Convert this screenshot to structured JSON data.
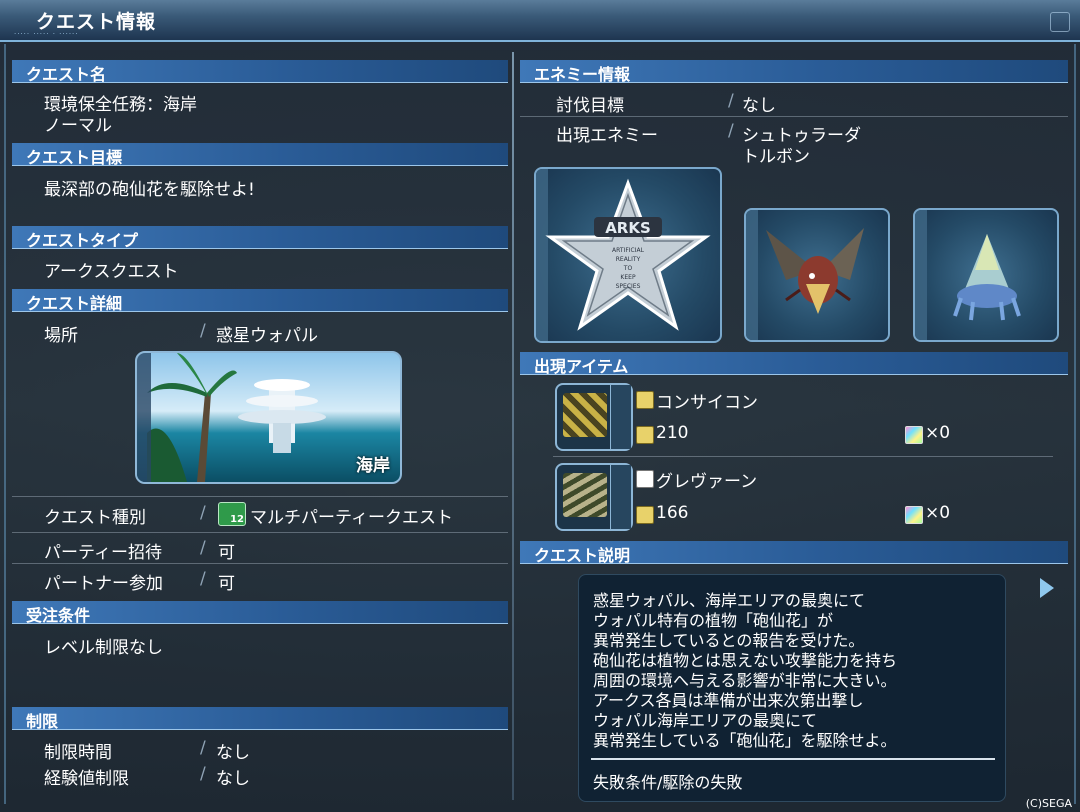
{
  "window": {
    "title": "クエスト情報",
    "subtitle": "..... ..... . ......",
    "copyright": "(C)SEGA"
  },
  "left": {
    "quest_name": {
      "header": "クエスト名",
      "name": "環境保全任務：海岸",
      "difficulty": "ノーマル"
    },
    "quest_goal": {
      "header": "クエスト目標",
      "text": "最深部の砲仙花を駆除せよ!"
    },
    "quest_type": {
      "header": "クエストタイプ",
      "text": "アークスクエスト"
    },
    "quest_detail": {
      "header": "クエスト詳細",
      "location_label": "場所",
      "location_value": "惑星ウォパル",
      "thumbnail_caption": "海岸",
      "rows": [
        {
          "label": "クエスト種別",
          "value": "マルチパーティークエスト",
          "badge": "12"
        },
        {
          "label": "パーティー招待",
          "value": "可"
        },
        {
          "label": "パートナー参加",
          "value": "可"
        }
      ]
    },
    "order_conditions": {
      "header": "受注条件",
      "text": "レベル制限なし"
    },
    "limits": {
      "header": "制限",
      "rows": [
        {
          "label": "制限時間",
          "value": "なし"
        },
        {
          "label": "経験値制限",
          "value": "なし"
        }
      ]
    }
  },
  "right": {
    "enemy_info": {
      "header": "エネミー情報",
      "target_label": "討伐目標",
      "target_value": "なし",
      "appear_label": "出現エネミー",
      "appear_values": [
        "シュトゥラーダ",
        "トルボン"
      ],
      "emblem_text": [
        "ARKS",
        "ARTIFICIAL",
        "REALITY",
        "TO",
        "KEEP",
        "SPECIES"
      ]
    },
    "items": {
      "header": "出現アイテム",
      "list": [
        {
          "name": "コンサイコン",
          "level": "210",
          "count": "×0"
        },
        {
          "name": "グレヴァーン",
          "level": "166",
          "count": "×0"
        }
      ]
    },
    "description": {
      "header": "クエスト説明",
      "lines": [
        "惑星ウォパル、海岸エリアの最奥にて",
        "ウォパル特有の植物「砲仙花」が",
        "異常発生しているとの報告を受けた。",
        "砲仙花は植物とは思えない攻撃能力を持ち",
        "周囲の環境へ与える影響が非常に大きい。",
        "アークス各員は準備が出来次第出撃し",
        "ウォパル海岸エリアの最奥にて",
        "異常発生している「砲仙花」を駆除せよ。"
      ],
      "fail_condition": "失敗条件/駆除の失敗"
    }
  },
  "colors": {
    "header_blue": "#3f78b8",
    "title_bar": "#3a5a78",
    "panel_bg": "#102233"
  }
}
